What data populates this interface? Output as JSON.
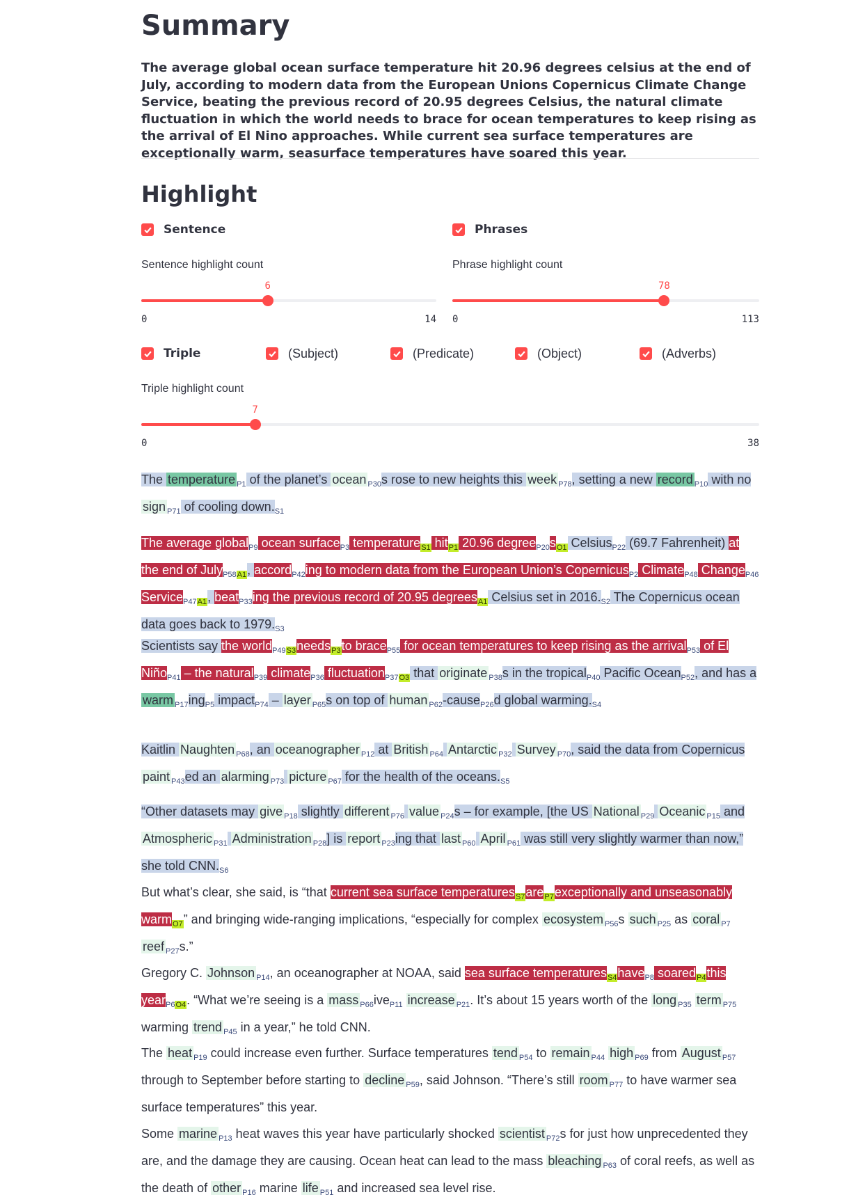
{
  "title": "Summary",
  "summary": "The average global ocean surface temperature hit 20.96 degrees celsius at the end of July, according to modern data from the European Unions Copernicus Climate Change Service, beating the previous record of 20.95 degrees Celsius, the natural climate fluctuation in which the world needs to brace for ocean temperatures to keep rising as the arrival of El Nino approaches. While current sea surface temperatures are exceptionally warm, seasurface temperatures have soared this year.",
  "highlight_title": "Highlight",
  "checkboxes": {
    "sentence": "Sentence",
    "phrases": "Phrases",
    "triple": "Triple",
    "subject": "(Subject)",
    "predicate": "(Predicate)",
    "object": "(Object)",
    "adverbs": "(Adverbs)"
  },
  "sliders": {
    "sentence": {
      "label": "Sentence highlight count",
      "value": "6",
      "min": "0",
      "max": "14",
      "fraction": 0.4286
    },
    "phrase": {
      "label": "Phrase highlight count",
      "value": "78",
      "min": "0",
      "max": "113",
      "fraction": 0.6903
    },
    "triple": {
      "label": "Triple highlight count",
      "value": "7",
      "min": "0",
      "max": "38",
      "fraction": 0.1842
    }
  },
  "colors": {
    "accent": "#ff4b4b",
    "sentence_bg": "#c9d5e9",
    "triple_bg": "#bd2d45",
    "phrase_bg": "#e4f5ea",
    "tag_bg": "#c3ec2a"
  },
  "paragraphs": [
    [
      [
        "s",
        "The "
      ],
      [
        "gd",
        "temperature"
      ],
      [
        "sub",
        "P1"
      ],
      [
        "s",
        " of the planet’s "
      ],
      [
        "g",
        "ocean"
      ],
      [
        "sub",
        "P30"
      ],
      [
        "s",
        "s rose to new heights this "
      ],
      [
        "g",
        "week"
      ],
      [
        "sub",
        "P78"
      ],
      [
        "s",
        ", setting a new "
      ],
      [
        "gd",
        "record"
      ],
      [
        "sub",
        "P10"
      ],
      [
        "s",
        " with no "
      ],
      [
        "g",
        "sign"
      ],
      [
        "sub",
        "P71"
      ],
      [
        "s",
        " of cooling down."
      ],
      [
        "sb",
        "S1"
      ]
    ],
    [
      [
        "r",
        "The average "
      ],
      [
        "r",
        "global"
      ],
      [
        "sub",
        "P9"
      ],
      [
        "r",
        " ocean "
      ],
      [
        "r",
        "surface"
      ],
      [
        "sub",
        "P3"
      ],
      [
        "r",
        " temperature"
      ],
      [
        "y",
        "S1"
      ],
      [
        "r",
        " hit"
      ],
      [
        "y",
        "P1"
      ],
      [
        "r",
        " 20.96 degree"
      ],
      [
        "sub",
        "P20"
      ],
      [
        "r",
        "s"
      ],
      [
        "y",
        "O1"
      ],
      [
        "s",
        " Celsius"
      ],
      [
        "sub",
        "P22"
      ],
      [
        "s",
        " (69.7 Fahrenheit) "
      ],
      [
        "r",
        "at the end of July"
      ],
      [
        "sub",
        "P58"
      ],
      [
        "y",
        "A1"
      ],
      [
        "s",
        ", "
      ],
      [
        "r",
        "accord"
      ],
      [
        "sub",
        "P42"
      ],
      [
        "r",
        "ing to modern data from the European Union’s Copernicus"
      ],
      [
        "sub",
        "P2"
      ],
      [
        "r",
        " Climate"
      ],
      [
        "sub",
        "P48"
      ],
      [
        "r",
        " Change"
      ],
      [
        "sub",
        "P46"
      ],
      [
        "r",
        " Service"
      ],
      [
        "sub",
        "P47"
      ],
      [
        "y",
        "A1"
      ],
      [
        "s",
        ", "
      ],
      [
        "r",
        "beat"
      ],
      [
        "sub",
        "P33"
      ],
      [
        "r",
        "ing the previous record of 20.95 degrees"
      ],
      [
        "y",
        "A1"
      ],
      [
        "s",
        " Celsius set in 2016."
      ],
      [
        "sb",
        "S2"
      ],
      [
        "s",
        " The Copernicus ocean data goes back to 1979."
      ],
      [
        "sb",
        "S3"
      ]
    ],
    [
      [
        "s",
        "Scientists say "
      ],
      [
        "r",
        "the world"
      ],
      [
        "sub",
        "P49"
      ],
      [
        "y",
        "S3"
      ],
      [
        "r",
        "needs"
      ],
      [
        "y",
        "P3"
      ],
      [
        "r",
        "to brace"
      ],
      [
        "sub",
        "P55"
      ],
      [
        "r",
        " for ocean temperatures to keep rising as the arrival"
      ],
      [
        "sub",
        "P53"
      ],
      [
        "r",
        " of El Niño"
      ],
      [
        "sub",
        "P41"
      ],
      [
        "r",
        " – the natural"
      ],
      [
        "sub",
        "P39"
      ],
      [
        "r",
        " climate"
      ],
      [
        "sub",
        "P36"
      ],
      [
        "r",
        " fluctuation"
      ],
      [
        "sub",
        "P37"
      ],
      [
        "y",
        "O3"
      ],
      [
        "s",
        " that "
      ],
      [
        "g",
        "originate"
      ],
      [
        "sub",
        "P38"
      ],
      [
        "s",
        "s in the tropical"
      ],
      [
        "sub",
        "P40"
      ],
      [
        "s",
        " Pacific Ocean"
      ],
      [
        "sub",
        "P52"
      ],
      [
        "s",
        ", and has a "
      ],
      [
        "gd",
        "warm"
      ],
      [
        "sub",
        "P17"
      ],
      [
        "s",
        "ing"
      ],
      [
        "sub",
        "P5"
      ],
      [
        "s",
        " impact"
      ],
      [
        "sub",
        "P74"
      ],
      [
        "s",
        " – "
      ],
      [
        "g",
        "layer"
      ],
      [
        "sub",
        "P65"
      ],
      [
        "s",
        "s on top of "
      ],
      [
        "g",
        "human"
      ],
      [
        "sub",
        "P62"
      ],
      [
        "s",
        "-cause"
      ],
      [
        "sub",
        "P26"
      ],
      [
        "s",
        "d global warming."
      ],
      [
        "sb",
        "S4"
      ]
    ],
    [
      [
        "s",
        "Kaitlin "
      ],
      [
        "g",
        "Naughten"
      ],
      [
        "sub",
        "P68"
      ],
      [
        "s",
        ", an "
      ],
      [
        "g",
        "oceanographer"
      ],
      [
        "sub",
        "P12"
      ],
      [
        "s",
        " at "
      ],
      [
        "g",
        "British"
      ],
      [
        "sub",
        "P64"
      ],
      [
        "s",
        " "
      ],
      [
        "g",
        "Antarctic"
      ],
      [
        "sub",
        "P32"
      ],
      [
        "s",
        " "
      ],
      [
        "g",
        "Survey"
      ],
      [
        "sub",
        "P70"
      ],
      [
        "s",
        ", said the data from Copernicus "
      ],
      [
        "g",
        "paint"
      ],
      [
        "sub",
        "P43"
      ],
      [
        "s",
        "ed an "
      ],
      [
        "g",
        "alarming"
      ],
      [
        "sub",
        "P73"
      ],
      [
        "s",
        " "
      ],
      [
        "g",
        "picture"
      ],
      [
        "sub",
        "P67"
      ],
      [
        "s",
        " for the health of the oceans."
      ],
      [
        "sb",
        "S5"
      ]
    ],
    [
      [
        "s",
        "“Other datasets may "
      ],
      [
        "g",
        "give"
      ],
      [
        "sub",
        "P18"
      ],
      [
        "s",
        " slightly "
      ],
      [
        "g",
        "different"
      ],
      [
        "sub",
        "P76"
      ],
      [
        "s",
        " "
      ],
      [
        "g",
        "value"
      ],
      [
        "sub",
        "P24"
      ],
      [
        "s",
        "s – for example, [the US "
      ],
      [
        "g",
        "National"
      ],
      [
        "sub",
        "P29"
      ],
      [
        "s",
        " "
      ],
      [
        "g",
        "Oceanic"
      ],
      [
        "sub",
        "P15"
      ],
      [
        "s",
        " and "
      ],
      [
        "g",
        "Atmospheric"
      ],
      [
        "sub",
        "P31"
      ],
      [
        "s",
        " "
      ],
      [
        "g",
        "Administration"
      ],
      [
        "sub",
        "P28"
      ],
      [
        "s",
        "] is "
      ],
      [
        "g",
        "report"
      ],
      [
        "sub",
        "P23"
      ],
      [
        "s",
        "ing that "
      ],
      [
        "g",
        "last"
      ],
      [
        "sub",
        "P60"
      ],
      [
        "s",
        " "
      ],
      [
        "g",
        "April"
      ],
      [
        "sub",
        "P61"
      ],
      [
        "s",
        " was still very slightly warmer than now,” she told CNN."
      ],
      [
        "sb",
        "S6"
      ]
    ],
    [
      [
        "p",
        "But what’s clear, she said, is “that "
      ],
      [
        "r",
        "current sea surface temperatures"
      ],
      [
        "y",
        "S7"
      ],
      [
        "r",
        "are"
      ],
      [
        "y",
        "P7"
      ],
      [
        "r",
        "exceptionally and unseasonably warm"
      ],
      [
        "y",
        "O7"
      ],
      [
        "p",
        "” and bringing wide-ranging implications, “especially for complex "
      ],
      [
        "g",
        "ecosystem"
      ],
      [
        "sub",
        "P56"
      ],
      [
        "p",
        "s "
      ],
      [
        "g",
        "such"
      ],
      [
        "sub",
        "P25"
      ],
      [
        "p",
        " as "
      ],
      [
        "g",
        "coral"
      ],
      [
        "sub",
        "P7"
      ],
      [
        "p",
        " "
      ],
      [
        "g",
        "reef"
      ],
      [
        "sub",
        "P27"
      ],
      [
        "p",
        "s.”"
      ]
    ],
    [
      [
        "p",
        "Gregory C. "
      ],
      [
        "g",
        "Johnson"
      ],
      [
        "sub",
        "P14"
      ],
      [
        "p",
        ", an oceanographer at NOAA, said "
      ],
      [
        "r",
        "sea surface temperatures"
      ],
      [
        "y",
        "S4"
      ],
      [
        "r",
        "have"
      ],
      [
        "sub",
        "P8"
      ],
      [
        "r",
        " soared"
      ],
      [
        "y",
        "P4"
      ],
      [
        "r",
        "this year"
      ],
      [
        "sub",
        "P6"
      ],
      [
        "y",
        "O4"
      ],
      [
        "p",
        ". “What we’re seeing is a "
      ],
      [
        "g",
        "mass"
      ],
      [
        "sub",
        "P66"
      ],
      [
        "p",
        "ive"
      ],
      [
        "sub",
        "P11"
      ],
      [
        "p",
        " "
      ],
      [
        "g",
        "increase"
      ],
      [
        "sub",
        "P21"
      ],
      [
        "p",
        ". It’s about 15 years worth of the "
      ],
      [
        "g",
        "long"
      ],
      [
        "sub",
        "P35"
      ],
      [
        "p",
        " "
      ],
      [
        "g",
        "term"
      ],
      [
        "sub",
        "P75"
      ],
      [
        "p",
        " warming "
      ],
      [
        "g",
        "trend"
      ],
      [
        "sub",
        "P45"
      ],
      [
        "p",
        " in a year,” he told CNN."
      ]
    ],
    [
      [
        "p",
        "The "
      ],
      [
        "g",
        "heat"
      ],
      [
        "sub",
        "P19"
      ],
      [
        "p",
        " could increase even further. Surface temperatures "
      ],
      [
        "g",
        "tend"
      ],
      [
        "sub",
        "P54"
      ],
      [
        "p",
        " to "
      ],
      [
        "g",
        "remain"
      ],
      [
        "sub",
        "P44"
      ],
      [
        "p",
        " "
      ],
      [
        "g",
        "high"
      ],
      [
        "sub",
        "P69"
      ],
      [
        "p",
        " from "
      ],
      [
        "g",
        "August"
      ],
      [
        "sub",
        "P57"
      ],
      [
        "p",
        " through to September before starting to "
      ],
      [
        "g",
        "decline"
      ],
      [
        "sub",
        "P59"
      ],
      [
        "p",
        ", said Johnson. “There’s still "
      ],
      [
        "g",
        "room"
      ],
      [
        "sub",
        "P77"
      ],
      [
        "p",
        " to have warmer sea surface temperatures” this year."
      ]
    ],
    [
      [
        "p",
        "Some "
      ],
      [
        "g",
        "marine"
      ],
      [
        "sub",
        "P13"
      ],
      [
        "p",
        " heat waves this year have particularly shocked "
      ],
      [
        "g",
        "scientist"
      ],
      [
        "sub",
        "P72"
      ],
      [
        "p",
        "s for just how unprecedented they are, and the damage they are causing. Ocean heat can lead to the mass "
      ],
      [
        "g",
        "bleaching"
      ],
      [
        "sub",
        "P63"
      ],
      [
        "p",
        " of coral reefs, as well as the death of "
      ],
      [
        "g",
        "other"
      ],
      [
        "sub",
        "P16"
      ],
      [
        "p",
        " marine "
      ],
      [
        "g",
        "life"
      ],
      [
        "sub",
        "P51"
      ],
      [
        "p",
        " and increased sea level rise."
      ]
    ]
  ]
}
